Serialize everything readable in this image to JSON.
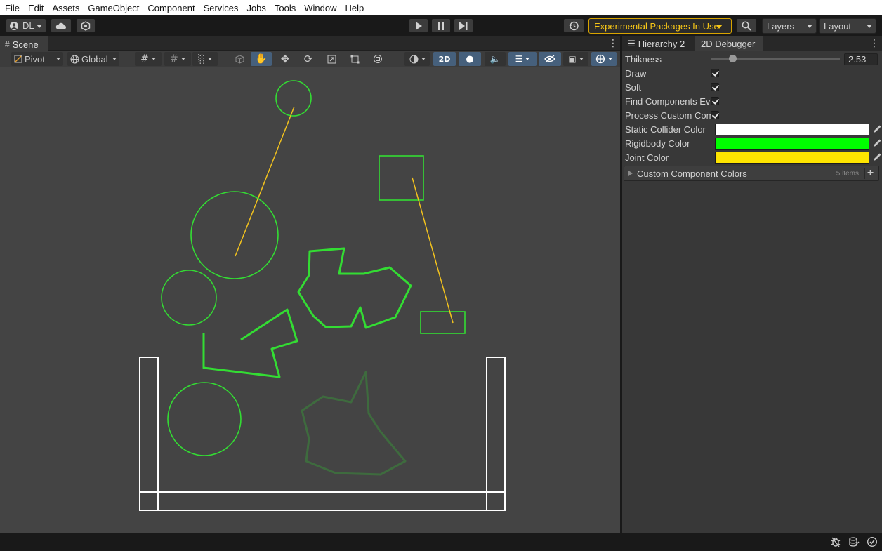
{
  "menu": [
    "File",
    "Edit",
    "Assets",
    "GameObject",
    "Component",
    "Services",
    "Jobs",
    "Tools",
    "Window",
    "Help"
  ],
  "toolbar": {
    "account_label": "DL",
    "experimental_label": "Experimental Packages In Use",
    "layers_label": "Layers",
    "layout_label": "Layout",
    "experimental_color": "#f5c518"
  },
  "scene": {
    "tab_label": "Scene",
    "pivot_label": "Pivot",
    "global_label": "Global",
    "mode_2d_label": "2D"
  },
  "inspector": {
    "tabs": [
      {
        "label": "Hierarchy 2",
        "active": false
      },
      {
        "label": "2D Debugger",
        "active": true
      }
    ],
    "thickness": {
      "label": "Thikness",
      "value": "2.53",
      "fraction": 0.17
    },
    "toggles": [
      {
        "label": "Draw",
        "checked": true
      },
      {
        "label": "Soft",
        "checked": true
      },
      {
        "label": "Find Components Eve",
        "checked": true
      },
      {
        "label": "Process Custom Com",
        "checked": true
      }
    ],
    "colors": [
      {
        "label": "Static Collider Color",
        "value": "#ffffff"
      },
      {
        "label": "Rigidbody Color",
        "value": "#00ff00"
      },
      {
        "label": "Joint Color",
        "value": "#ffe500"
      }
    ],
    "custom_colors": {
      "label": "Custom Component Colors",
      "count": "5 items"
    }
  },
  "debug_colors": {
    "rigidbody": "#33dd33",
    "sleeping_rigidbody": "#3e6b3e",
    "static": "#ffffff",
    "joint": "#f2c21e"
  }
}
